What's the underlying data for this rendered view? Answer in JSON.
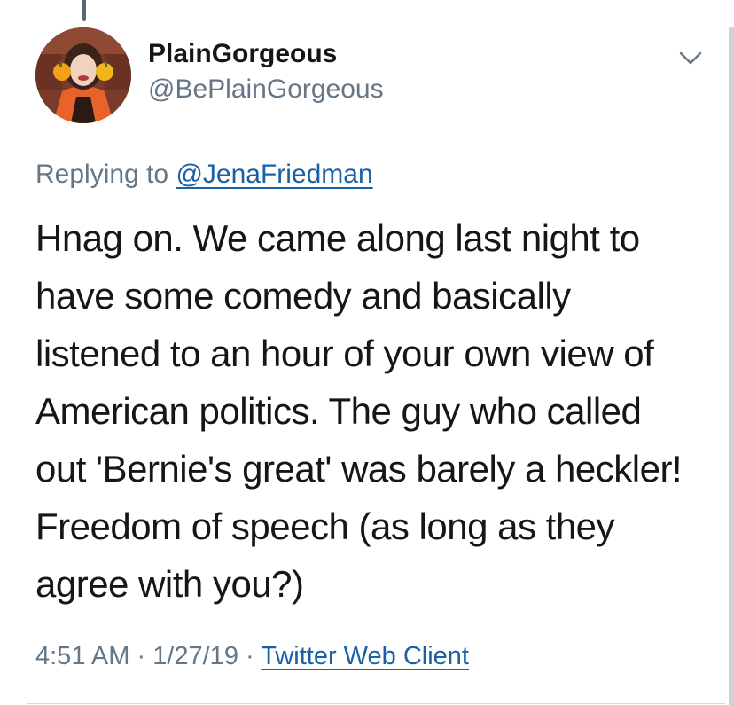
{
  "author": {
    "display_name": "PlainGorgeous",
    "handle": "@BePlainGorgeous",
    "avatar_icon": "profile-photo"
  },
  "reply": {
    "prefix": "Replying to ",
    "mention": "@JenaFriedman"
  },
  "tweet": {
    "lines": [
      "Hnag on. We came along last night to",
      "have some comedy and basically",
      "listened to an hour of your own view of",
      "American politics. The guy who called",
      "out 'Bernie's great' was barely a heckler!",
      "Freedom of speech (as long as they",
      "agree with you?)"
    ]
  },
  "meta": {
    "time": "4:51 AM",
    "separator": " · ",
    "date": "1/27/19",
    "source": "Twitter Web Client"
  },
  "colors": {
    "text": "#14171a",
    "secondary": "#657786",
    "link": "#1b5fa6"
  },
  "icons": {
    "more": "chevron-down-icon"
  }
}
